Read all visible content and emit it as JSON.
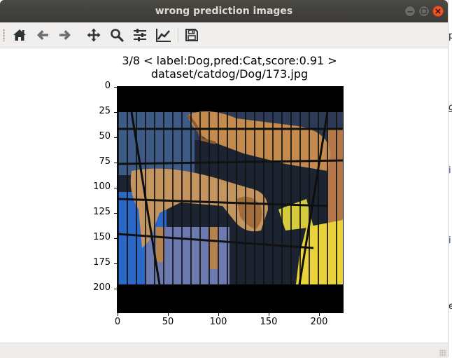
{
  "window": {
    "title": "wrong prediction images",
    "controls": [
      "minimize-icon",
      "maximize-icon",
      "close-icon"
    ]
  },
  "toolbar": {
    "buttons": [
      {
        "icon": "home-icon",
        "name": "home"
      },
      {
        "icon": "arrow-left-icon",
        "name": "back"
      },
      {
        "icon": "arrow-right-icon",
        "name": "forward"
      },
      {
        "icon": "move-icon",
        "name": "pan"
      },
      {
        "icon": "zoom-icon",
        "name": "zoom"
      },
      {
        "icon": "sliders-icon",
        "name": "configure-subplots"
      },
      {
        "icon": "line-chart-icon",
        "name": "edit-axis"
      },
      {
        "icon": "save-icon",
        "name": "save-figure"
      }
    ]
  },
  "figure": {
    "title_line1": "3/8 < label:Dog,pred:Cat,score:0.91 >",
    "title_line2": "dataset/catdog/Dog/173.jpg",
    "image_description": "two dogs inside a black wire crate",
    "yticks": [
      "0",
      "25",
      "50",
      "75",
      "100",
      "125",
      "150",
      "175",
      "200"
    ],
    "xticks": [
      "0",
      "50",
      "100",
      "150",
      "200"
    ]
  },
  "colors": {
    "titlebar": "#3f3e3a",
    "close_button": "#e9552c",
    "toolbar": "#f0efed",
    "icon": "#2e3436"
  }
}
